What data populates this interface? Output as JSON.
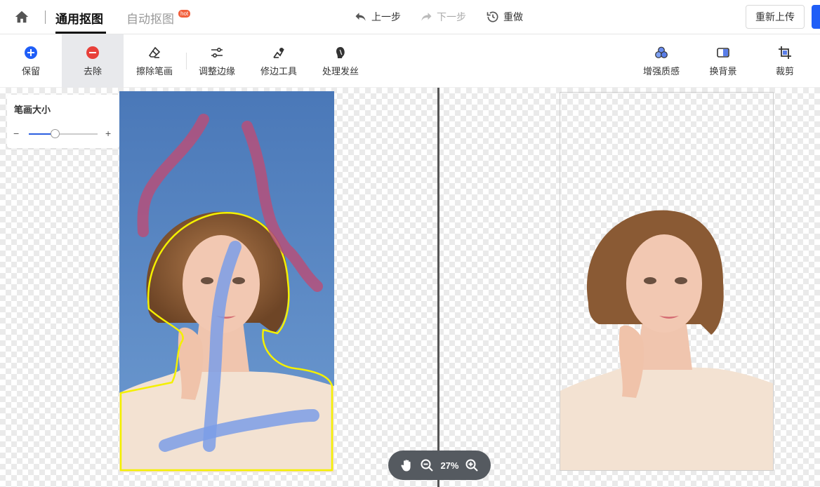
{
  "header": {
    "tabs": [
      {
        "label": "通用抠图",
        "active": true
      },
      {
        "label": "自动抠图",
        "active": false,
        "badge": "hot"
      }
    ],
    "history": {
      "undo": "上一步",
      "redo": "下一步",
      "redo_all": "重做"
    },
    "reupload": "重新上传"
  },
  "toolbar": {
    "left": [
      {
        "label": "保留",
        "icon": "plus-circle-icon",
        "color": "#1f5ef7"
      },
      {
        "label": "去除",
        "icon": "minus-circle-icon",
        "color": "#e8403a",
        "active": true
      },
      {
        "label": "擦除笔画",
        "icon": "eraser-icon"
      },
      {
        "label": "调整边缘",
        "icon": "sliders-icon"
      },
      {
        "label": "修边工具",
        "icon": "edge-brush-icon"
      },
      {
        "label": "处理发丝",
        "icon": "hair-icon"
      }
    ],
    "right": [
      {
        "label": "增强质感",
        "icon": "enhance-circles-icon"
      },
      {
        "label": "换背景",
        "icon": "background-swap-icon"
      },
      {
        "label": "裁剪",
        "icon": "crop-icon"
      }
    ]
  },
  "brush": {
    "title": "笔画大小",
    "minus": "−",
    "plus": "+",
    "size_fraction": 0.38
  },
  "zoom": {
    "level": "27%"
  },
  "colors": {
    "accent": "#1f5ef7",
    "remove": "#e8403a",
    "keep_stroke": "#7b9ee8",
    "remove_stroke": "#b5507a",
    "outline": "#f4f000"
  }
}
